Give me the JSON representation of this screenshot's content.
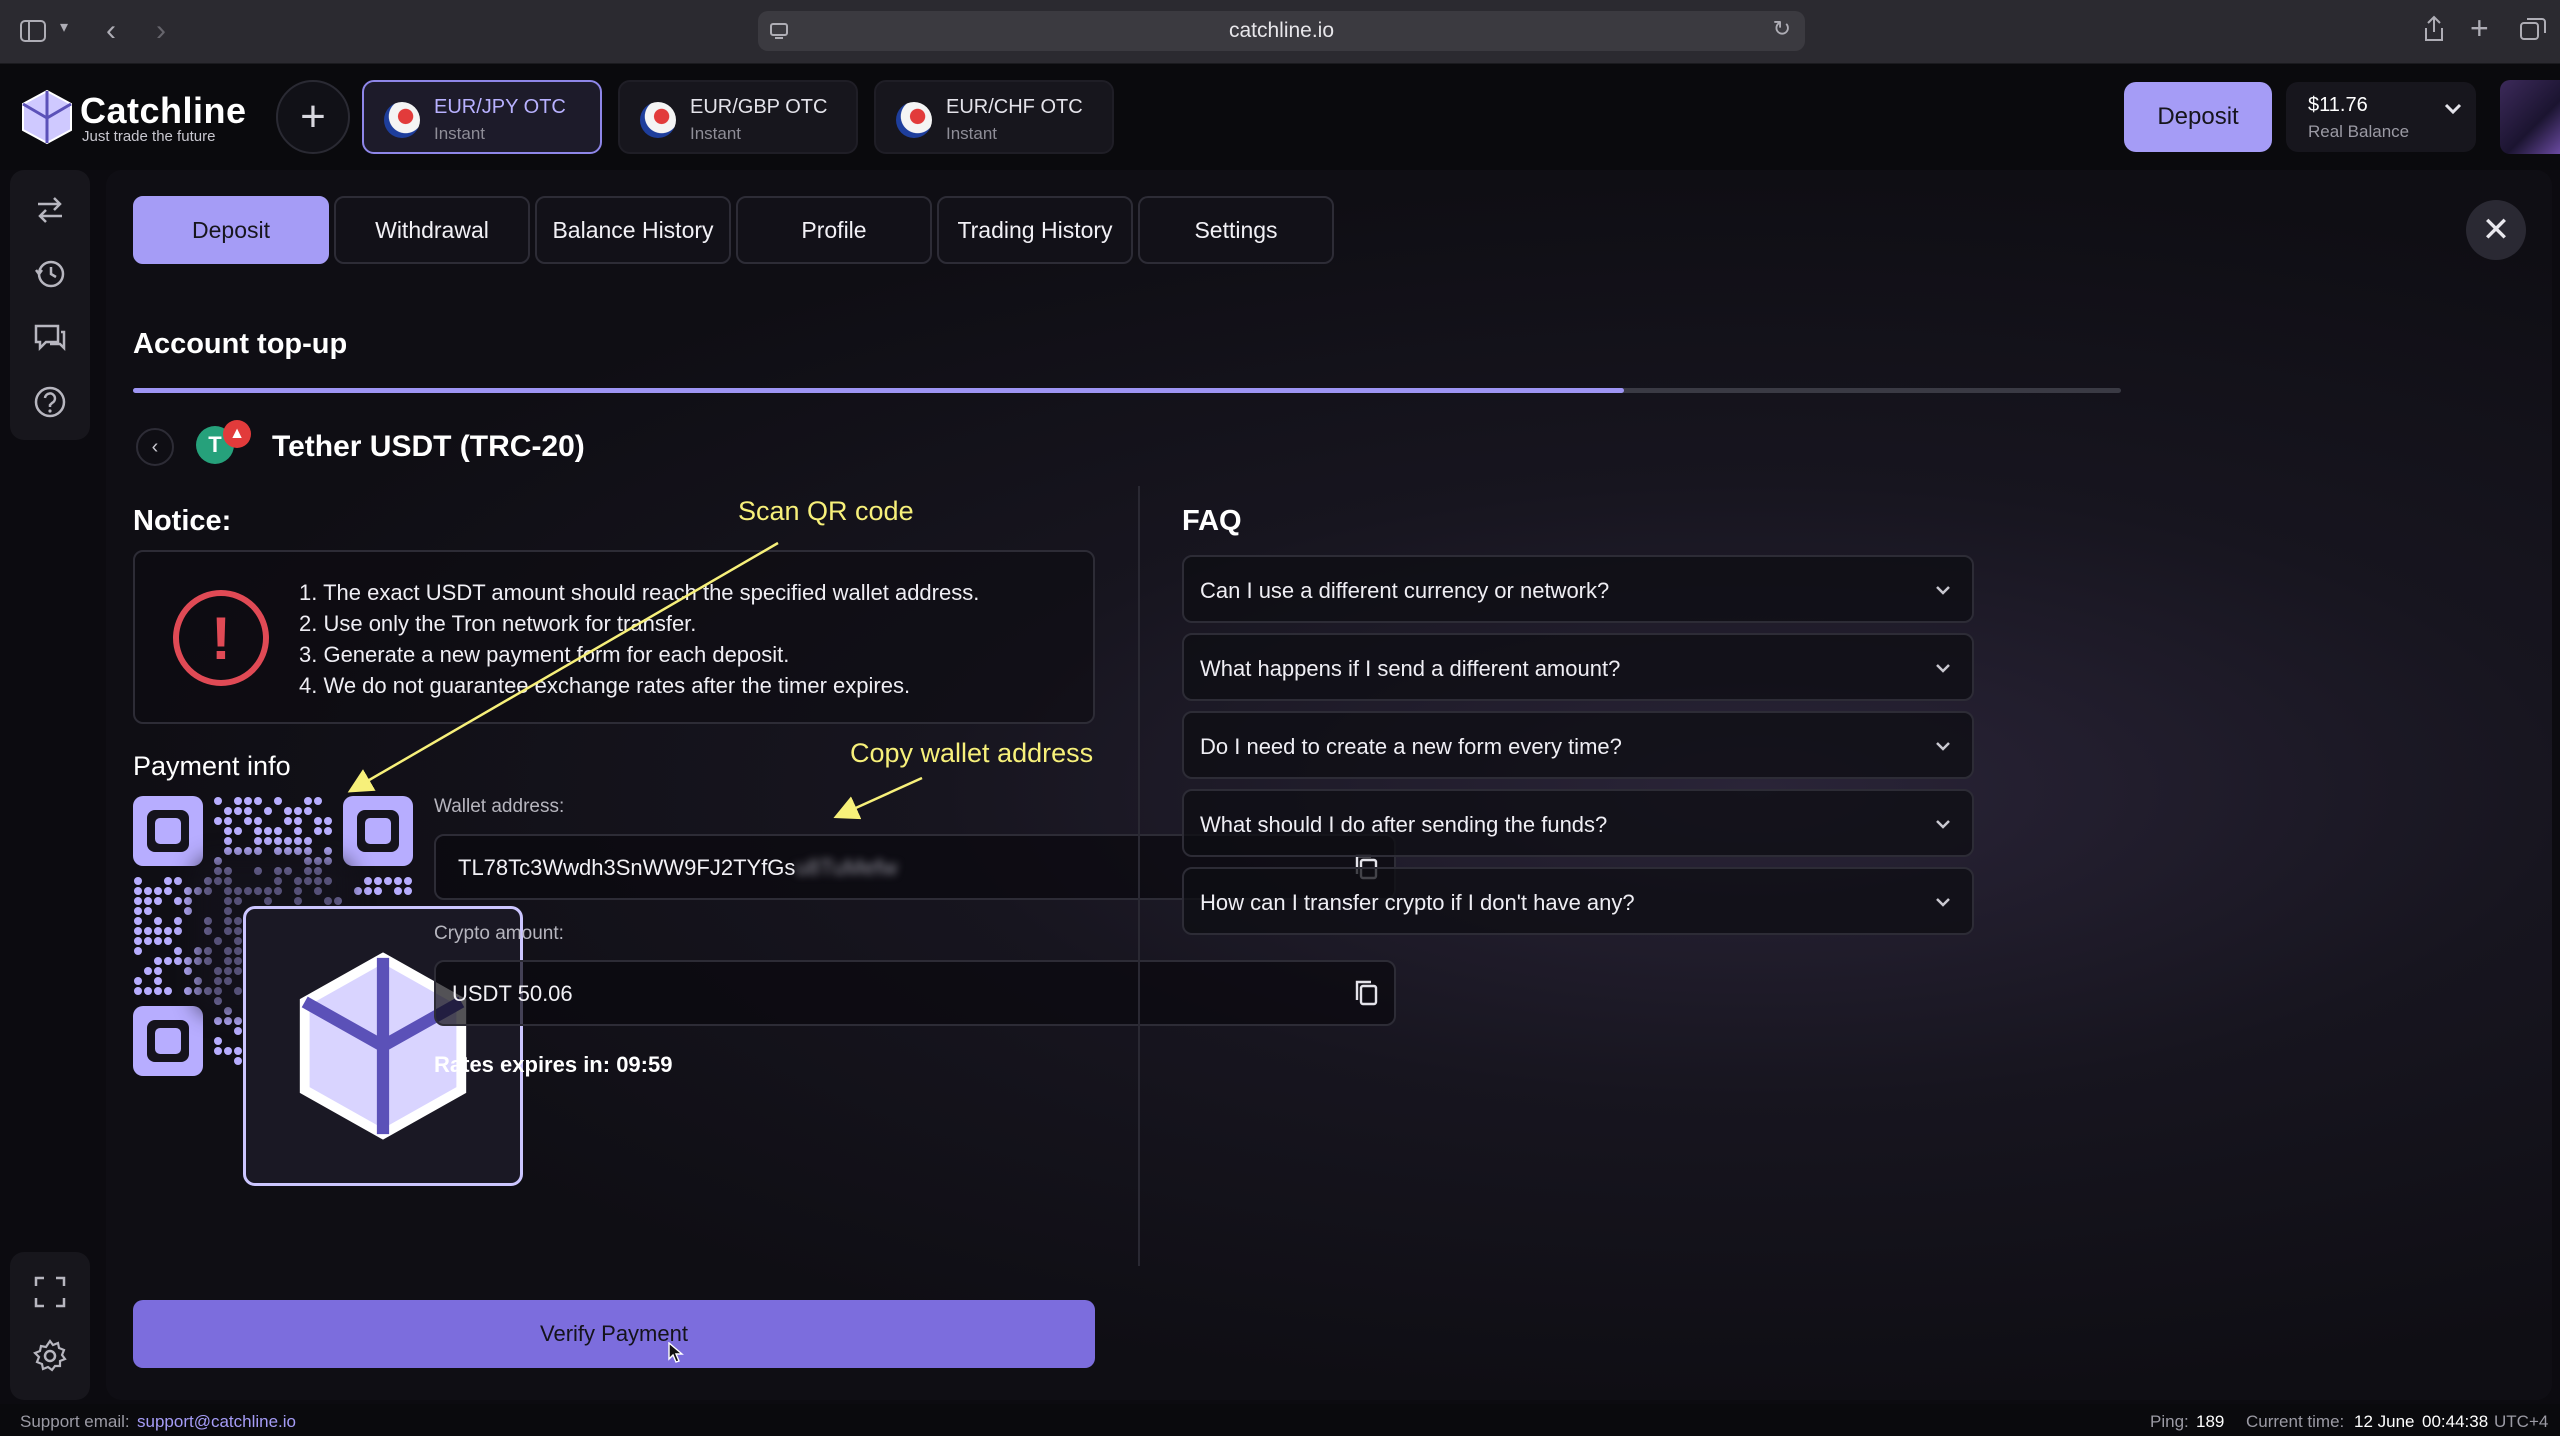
{
  "browser": {
    "url": "catchline.io"
  },
  "brand": {
    "name": "Catchline",
    "tagline": "Just trade the future"
  },
  "assets": [
    {
      "name": "EUR/JPY OTC",
      "sub": "Instant",
      "active": true
    },
    {
      "name": "EUR/GBP OTC",
      "sub": "Instant",
      "active": false
    },
    {
      "name": "EUR/CHF OTC",
      "sub": "Instant",
      "active": false
    }
  ],
  "header": {
    "deposit_label": "Deposit",
    "balance_amount": "$11.76",
    "balance_label": "Real Balance"
  },
  "tabs": [
    "Deposit",
    "Withdrawal",
    "Balance History",
    "Profile",
    "Trading History",
    "Settings"
  ],
  "topup": {
    "title": "Account top-up",
    "progress": 0.75,
    "coin": "Tether USDT (TRC-20)"
  },
  "notice": {
    "title": "Notice:",
    "lines": [
      "1. The exact USDT amount should reach the specified wallet address.",
      "2. Use only the Tron network for transfer.",
      "3. Generate a new payment form for each deposit.",
      "4. We do not guarantee exchange rates after the timer expires."
    ]
  },
  "payment": {
    "title": "Payment info",
    "wallet_label": "Wallet address:",
    "wallet_visible": "TL78Tc3Wwdh3SnWW9FJ2TYfGs",
    "wallet_blurred": "u8TuMefw",
    "amount_label": "Crypto amount:",
    "amount_value": "USDT 50.06",
    "rates": "Rates expires in: 09:59",
    "verify_label": "Verify Payment"
  },
  "faq": {
    "title": "FAQ",
    "items": [
      "Can I use a different currency or network?",
      "What happens if I send a different amount?",
      "Do I need to create a new form every time?",
      "What should I do after sending the funds?",
      "How can I transfer crypto if I don't have any?"
    ]
  },
  "annotations": {
    "qr": "Scan QR code",
    "wallet": "Copy wallet address"
  },
  "footer": {
    "support_label": "Support email:",
    "support_email": "support@catchline.io",
    "ping_label": "Ping:",
    "ping_value": "189",
    "time_label": "Current time:",
    "date_value": "12 June",
    "time_value": "00:44:38",
    "tz": "UTC+4"
  },
  "colors": {
    "accent": "#a59cf6",
    "verify": "#7c6ddd",
    "annotation": "#f7f07a",
    "warning": "#e04a55"
  }
}
